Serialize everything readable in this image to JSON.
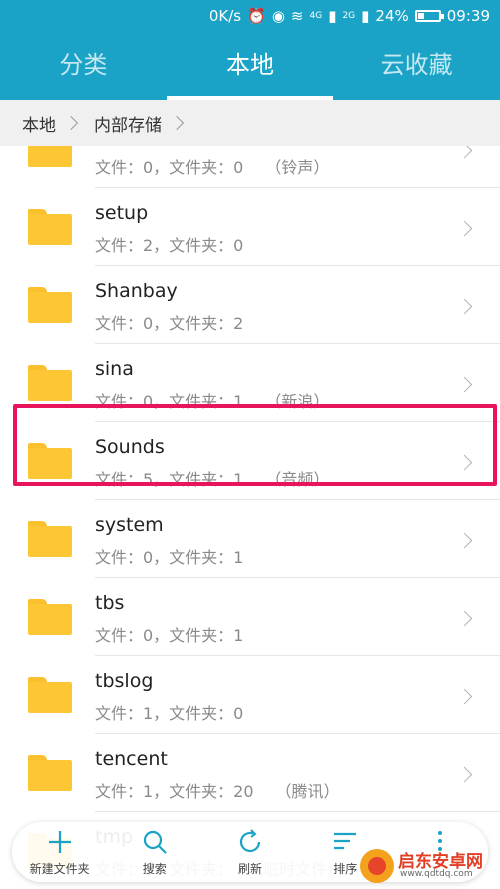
{
  "status_bar": {
    "speed": "0K/s",
    "network1": "4G",
    "network2": "2G",
    "battery": "24%",
    "time": "09:39"
  },
  "tabs": [
    {
      "label": "分类",
      "active": false
    },
    {
      "label": "本地",
      "active": true
    },
    {
      "label": "云收藏",
      "active": false
    }
  ],
  "breadcrumb": [
    "本地",
    "内部存储"
  ],
  "folders": [
    {
      "name": "",
      "meta": "文件：0，文件夹：0",
      "note": "（铃声）"
    },
    {
      "name": "setup",
      "meta": "文件：2，文件夹：0",
      "note": ""
    },
    {
      "name": "Shanbay",
      "meta": "文件：0，文件夹：2",
      "note": ""
    },
    {
      "name": "sina",
      "meta": "文件：0，文件夹：1",
      "note": "（新浪）"
    },
    {
      "name": "Sounds",
      "meta": "文件：5，文件夹：1",
      "note": "（音频）"
    },
    {
      "name": "system",
      "meta": "文件：0，文件夹：1",
      "note": ""
    },
    {
      "name": "tbs",
      "meta": "文件：0，文件夹：1",
      "note": ""
    },
    {
      "name": "tbslog",
      "meta": "文件：1，文件夹：0",
      "note": ""
    },
    {
      "name": "tencent",
      "meta": "文件：1，文件夹：20",
      "note": "（腾讯）"
    },
    {
      "name": "tmp",
      "meta": "文件：1，文件夹：",
      "note": "（临时文件）"
    }
  ],
  "bottom_actions": [
    {
      "label": "新建文件夹",
      "icon": "plus-icon"
    },
    {
      "label": "搜索",
      "icon": "search-icon"
    },
    {
      "label": "刷新",
      "icon": "refresh-icon"
    },
    {
      "label": "排序",
      "icon": "sort-icon"
    },
    {
      "label": "更多",
      "icon": "more-icon"
    }
  ],
  "watermark": {
    "title": "启东安卓网",
    "url": "www.qdtdq.com"
  },
  "colors": {
    "accent": "#1aa3c6",
    "folder": "#fdc635",
    "highlight": "#e8155d"
  }
}
